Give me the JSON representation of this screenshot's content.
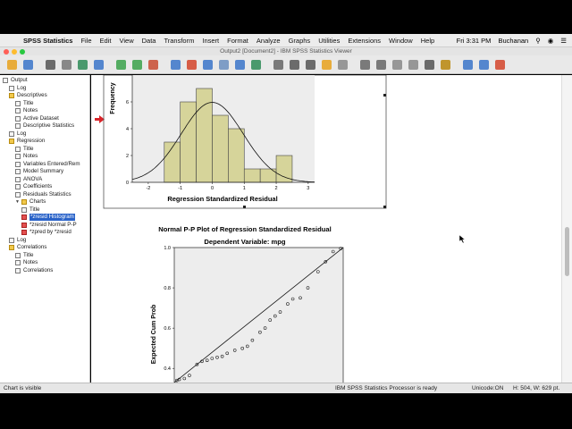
{
  "menubar": {
    "app": "SPSS Statistics",
    "items": [
      "File",
      "Edit",
      "View",
      "Data",
      "Transform",
      "Insert",
      "Format",
      "Analyze",
      "Graphs",
      "Utilities",
      "Extensions",
      "Window",
      "Help"
    ],
    "clock": "Fri 3:31 PM",
    "user": "Buchanan"
  },
  "window": {
    "title": "Output2 [Document2] - IBM SPSS Statistics Viewer"
  },
  "toolbar": {
    "icons": [
      "open-icon",
      "save-icon",
      "print-icon",
      "print-preview-icon",
      "export-icon",
      "recall-dialog-icon",
      "undo-icon",
      "redo-icon",
      "goto-data-icon",
      "goto-case-icon",
      "goto-variable-icon",
      "variables-icon",
      "run-descriptives-icon",
      "find-icon",
      "split-file-icon",
      "select-cases-icon",
      "weight-cases-icon",
      "value-labels-icon",
      "use-variable-sets-icon",
      "designate-window-icon",
      "back-icon",
      "forward-icon",
      "expand-icon",
      "collapse-icon",
      "show-icon",
      "hide-icon",
      "insert-heading-icon",
      "insert-title-icon",
      "insert-text-icon"
    ]
  },
  "tree": [
    {
      "label": "Output",
      "level": 0,
      "type": "root"
    },
    {
      "label": "Log",
      "level": 1,
      "type": "doc"
    },
    {
      "label": "Descriptives",
      "level": 1,
      "type": "book"
    },
    {
      "label": "Title",
      "level": 2,
      "type": "doc"
    },
    {
      "label": "Notes",
      "level": 2,
      "type": "doc"
    },
    {
      "label": "Active Dataset",
      "level": 2,
      "type": "doc"
    },
    {
      "label": "Descriptive Statistics",
      "level": 2,
      "type": "doc"
    },
    {
      "label": "Log",
      "level": 1,
      "type": "doc"
    },
    {
      "label": "Regression",
      "level": 1,
      "type": "book"
    },
    {
      "label": "Title",
      "level": 2,
      "type": "doc"
    },
    {
      "label": "Notes",
      "level": 2,
      "type": "doc"
    },
    {
      "label": "Variables Entered/Rem",
      "level": 2,
      "type": "doc"
    },
    {
      "label": "Model Summary",
      "level": 2,
      "type": "doc"
    },
    {
      "label": "ANOVA",
      "level": 2,
      "type": "doc"
    },
    {
      "label": "Coefficients",
      "level": 2,
      "type": "doc"
    },
    {
      "label": "Residuals Statistics",
      "level": 2,
      "type": "doc"
    },
    {
      "label": "Charts",
      "level": 2,
      "type": "book",
      "expanded": true
    },
    {
      "label": "Title",
      "level": 3,
      "type": "doc"
    },
    {
      "label": "*zresid Histogram",
      "level": 3,
      "type": "chart",
      "selected": true
    },
    {
      "label": "*zresid Normal P-P",
      "level": 3,
      "type": "chart"
    },
    {
      "label": "*zpred by *zresid",
      "level": 3,
      "type": "chart"
    },
    {
      "label": "Log",
      "level": 1,
      "type": "doc"
    },
    {
      "label": "Correlations",
      "level": 1,
      "type": "book"
    },
    {
      "label": "Title",
      "level": 2,
      "type": "doc"
    },
    {
      "label": "Notes",
      "level": 2,
      "type": "doc"
    },
    {
      "label": "Correlations",
      "level": 2,
      "type": "doc"
    }
  ],
  "histogram": {
    "ylabel": "Frequency",
    "xlabel": "Regression Standardized Residual",
    "y_ticks": [
      "0",
      "2",
      "4",
      "6"
    ],
    "x_ticks": [
      "-2",
      "-1",
      "0",
      "1",
      "2",
      "3"
    ],
    "fill": "#d6d49a",
    "plot_bg": "#ededed"
  },
  "pp_plot": {
    "title": "Normal P-P Plot of Regression Standardized Residual",
    "subtitle": "Dependent Variable: mpg",
    "ylabel": "Expected Cum Prob",
    "y_ticks": [
      "1.0",
      "0.8",
      "0.6",
      "0.4"
    ],
    "plot_bg": "#ededed"
  },
  "chart_data": [
    {
      "type": "bar",
      "title": "",
      "xlabel": "Regression Standardized Residual",
      "ylabel": "Frequency",
      "bins": [
        {
          "from": -1.5,
          "to": -1.0,
          "value": 3
        },
        {
          "from": -1.0,
          "to": -0.5,
          "value": 6
        },
        {
          "from": -0.5,
          "to": 0.0,
          "value": 7
        },
        {
          "from": 0.0,
          "to": 0.5,
          "value": 5
        },
        {
          "from": 0.5,
          "to": 1.0,
          "value": 4
        },
        {
          "from": 1.0,
          "to": 1.5,
          "value": 1
        },
        {
          "from": 1.5,
          "to": 2.0,
          "value": 1
        },
        {
          "from": 2.0,
          "to": 2.5,
          "value": 2
        }
      ],
      "normal_curve": {
        "mean": 0,
        "sd": 0.97
      },
      "xlim": [
        -2.5,
        3.2
      ],
      "ylim": [
        0,
        8
      ]
    },
    {
      "type": "scatter",
      "title": "Normal P-P Plot of Regression Standardized Residual",
      "subtitle": "Dependent Variable: mpg",
      "xlabel": "",
      "ylabel": "Expected Cum Prob",
      "points": [
        [
          0.34,
          0.34
        ],
        [
          0.35,
          0.345
        ],
        [
          0.37,
          0.35
        ],
        [
          0.39,
          0.365
        ],
        [
          0.42,
          0.42
        ],
        [
          0.44,
          0.435
        ],
        [
          0.46,
          0.44
        ],
        [
          0.48,
          0.45
        ],
        [
          0.5,
          0.455
        ],
        [
          0.52,
          0.46
        ],
        [
          0.54,
          0.475
        ],
        [
          0.57,
          0.49
        ],
        [
          0.6,
          0.5
        ],
        [
          0.62,
          0.51
        ],
        [
          0.64,
          0.54
        ],
        [
          0.67,
          0.58
        ],
        [
          0.69,
          0.6
        ],
        [
          0.71,
          0.64
        ],
        [
          0.73,
          0.66
        ],
        [
          0.75,
          0.68
        ],
        [
          0.78,
          0.72
        ],
        [
          0.8,
          0.745
        ],
        [
          0.83,
          0.75
        ],
        [
          0.86,
          0.8
        ],
        [
          0.9,
          0.88
        ],
        [
          0.93,
          0.93
        ],
        [
          0.96,
          0.98
        ],
        [
          0.99,
          0.995
        ]
      ],
      "reference_line": [
        [
          0,
          0
        ],
        [
          1,
          1
        ]
      ],
      "xlim": [
        0.33,
        1.0
      ],
      "ylim": [
        0.33,
        1.0
      ]
    }
  ],
  "status": {
    "left": "Chart is visible",
    "processor": "IBM SPSS Statistics Processor is ready",
    "unicode": "Unicode:ON",
    "size": "H: 504, W: 629 pt."
  }
}
